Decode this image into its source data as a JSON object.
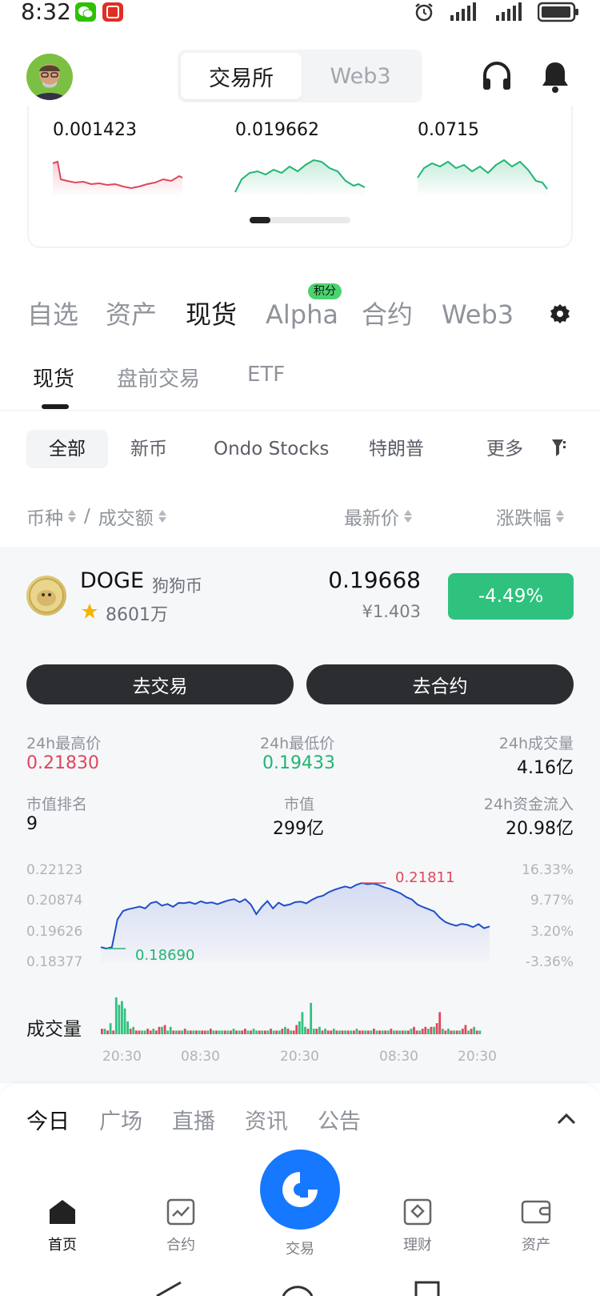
{
  "status": {
    "time": "8:32"
  },
  "header": {
    "segments": [
      "交易所",
      "Web3"
    ]
  },
  "mini_tickers": [
    "0.001423",
    "0.019662",
    "0.0715"
  ],
  "market_tabs": [
    "自选",
    "资产",
    "现货",
    "Alpha",
    "合约",
    "Web3"
  ],
  "alpha_badge": "积分",
  "sub_tabs": [
    "现货",
    "盘前交易",
    "ETF"
  ],
  "filters": [
    "全部",
    "新币",
    "Ondo Stocks",
    "特朗普",
    "更多"
  ],
  "columns": {
    "coin": "币种",
    "slash": "/",
    "volume": "成交额",
    "price": "最新价",
    "change": "涨跌幅"
  },
  "coin": {
    "symbol": "DOGE",
    "name_cn": "狗狗币",
    "volume": "8601万",
    "price": "0.19668",
    "price_cny": "¥1.403",
    "change": "-4.49%"
  },
  "actions": {
    "trade": "去交易",
    "futures": "去合约"
  },
  "stats": {
    "high_label": "24h最高价",
    "high": "0.21830",
    "low_label": "24h最低价",
    "low": "0.19433",
    "vol_label": "24h成交量",
    "vol": "4.16亿",
    "rank_label": "市值排名",
    "rank": "9",
    "mcap_label": "市值",
    "mcap": "299亿",
    "inflow_label": "24h资金流入",
    "inflow": "20.98亿"
  },
  "chart_data": {
    "type": "line",
    "y_left_ticks": [
      "0.22123",
      "0.20874",
      "0.19626",
      "0.18377"
    ],
    "y_right_ticks": [
      "16.33%",
      "9.77%",
      "3.20%",
      "-3.36%"
    ],
    "x_ticks": [
      "20:30",
      "08:30",
      "20:30",
      "08:30",
      "20:30"
    ],
    "ylim": [
      0.18377,
      0.22123
    ],
    "max_label": "0.21811",
    "min_label": "0.18690",
    "colors": {
      "line": "#1f4fc7",
      "max": "#e0465c",
      "min": "#21b573",
      "up": "#2ec27e",
      "down": "#e0465c"
    },
    "values": [
      0.1875,
      0.1869,
      0.1875,
      0.1995,
      0.2032,
      0.204,
      0.2045,
      0.2051,
      0.2043,
      0.2066,
      0.2072,
      0.2055,
      0.2062,
      0.205,
      0.2067,
      0.2066,
      0.207,
      0.2062,
      0.2074,
      0.2066,
      0.2069,
      0.2061,
      0.207,
      0.2078,
      0.2083,
      0.207,
      0.2083,
      0.206,
      0.2018,
      0.205,
      0.2075,
      0.2043,
      0.2068,
      0.2055,
      0.206,
      0.207,
      0.2072,
      0.2065,
      0.208,
      0.2092,
      0.2098,
      0.2113,
      0.2123,
      0.2131,
      0.2138,
      0.2132,
      0.2145,
      0.2153,
      0.2148,
      0.2151,
      0.2145,
      0.2135,
      0.2128,
      0.2118,
      0.2108,
      0.2092,
      0.2082,
      0.206,
      0.2049,
      0.204,
      0.203,
      0.2004,
      0.1984,
      0.1975,
      0.1968,
      0.1976,
      0.1972,
      0.1962,
      0.1975,
      0.1957,
      0.1965
    ],
    "volume_title": "成交量",
    "volume": [
      3,
      3,
      2,
      6,
      2,
      20,
      16,
      18,
      14,
      7,
      3,
      4,
      2,
      2,
      2,
      2,
      3,
      2,
      3,
      2,
      4,
      4,
      5,
      2,
      4,
      2,
      2,
      2,
      2,
      3,
      2,
      2,
      2,
      2,
      2,
      2,
      2,
      2,
      3,
      2,
      2,
      2,
      2,
      2,
      2,
      2,
      3,
      2,
      2,
      2,
      3,
      2,
      2,
      3,
      2,
      2,
      2,
      2,
      2,
      3,
      2,
      2,
      2,
      3,
      4,
      3,
      2,
      2,
      5,
      7,
      12,
      4,
      3,
      17,
      3,
      3,
      4,
      2,
      3,
      2,
      2,
      3,
      2,
      2,
      2,
      2,
      2,
      2,
      2,
      3,
      2,
      2,
      2,
      2,
      2,
      3,
      2,
      2,
      2,
      2,
      2,
      3,
      2,
      2,
      2,
      2,
      2,
      2,
      3,
      4,
      2,
      2,
      3,
      4,
      3,
      4,
      4,
      6,
      12,
      3,
      2,
      3,
      2,
      2,
      2,
      2,
      3,
      5,
      2,
      3,
      4,
      2,
      2
    ],
    "volume_up": [
      0,
      1,
      0,
      1,
      0,
      1,
      1,
      1,
      1,
      1,
      0,
      1,
      0,
      0,
      1,
      1,
      0,
      0,
      1,
      0,
      0,
      1,
      0,
      1,
      1,
      0,
      1,
      0,
      1,
      0,
      1,
      0,
      1,
      0,
      1,
      0,
      0,
      1,
      0,
      1,
      0,
      1,
      1,
      0,
      1,
      0,
      1,
      0,
      1,
      0,
      0,
      1,
      0,
      1,
      1,
      0,
      1,
      0,
      1,
      0,
      1,
      0,
      1,
      0,
      1,
      0,
      1,
      0,
      0,
      1,
      1,
      1,
      0,
      1,
      1,
      0,
      1,
      0,
      1,
      0,
      0,
      1,
      0,
      1,
      0,
      1,
      0,
      1,
      0,
      1,
      0,
      0,
      1,
      0,
      1,
      0,
      1,
      0,
      1,
      0,
      1,
      0,
      1,
      0,
      1,
      0,
      1,
      0,
      1,
      0,
      0,
      1,
      0,
      0,
      1,
      0,
      1,
      0,
      0,
      1,
      0,
      1,
      0,
      1,
      0,
      1,
      0,
      0,
      1,
      0,
      1,
      0,
      1
    ]
  },
  "news_tabs": [
    "今日",
    "广场",
    "直播",
    "资讯",
    "公告"
  ],
  "bottom_nav": [
    "首页",
    "合约",
    "交易",
    "理财",
    "资产"
  ]
}
